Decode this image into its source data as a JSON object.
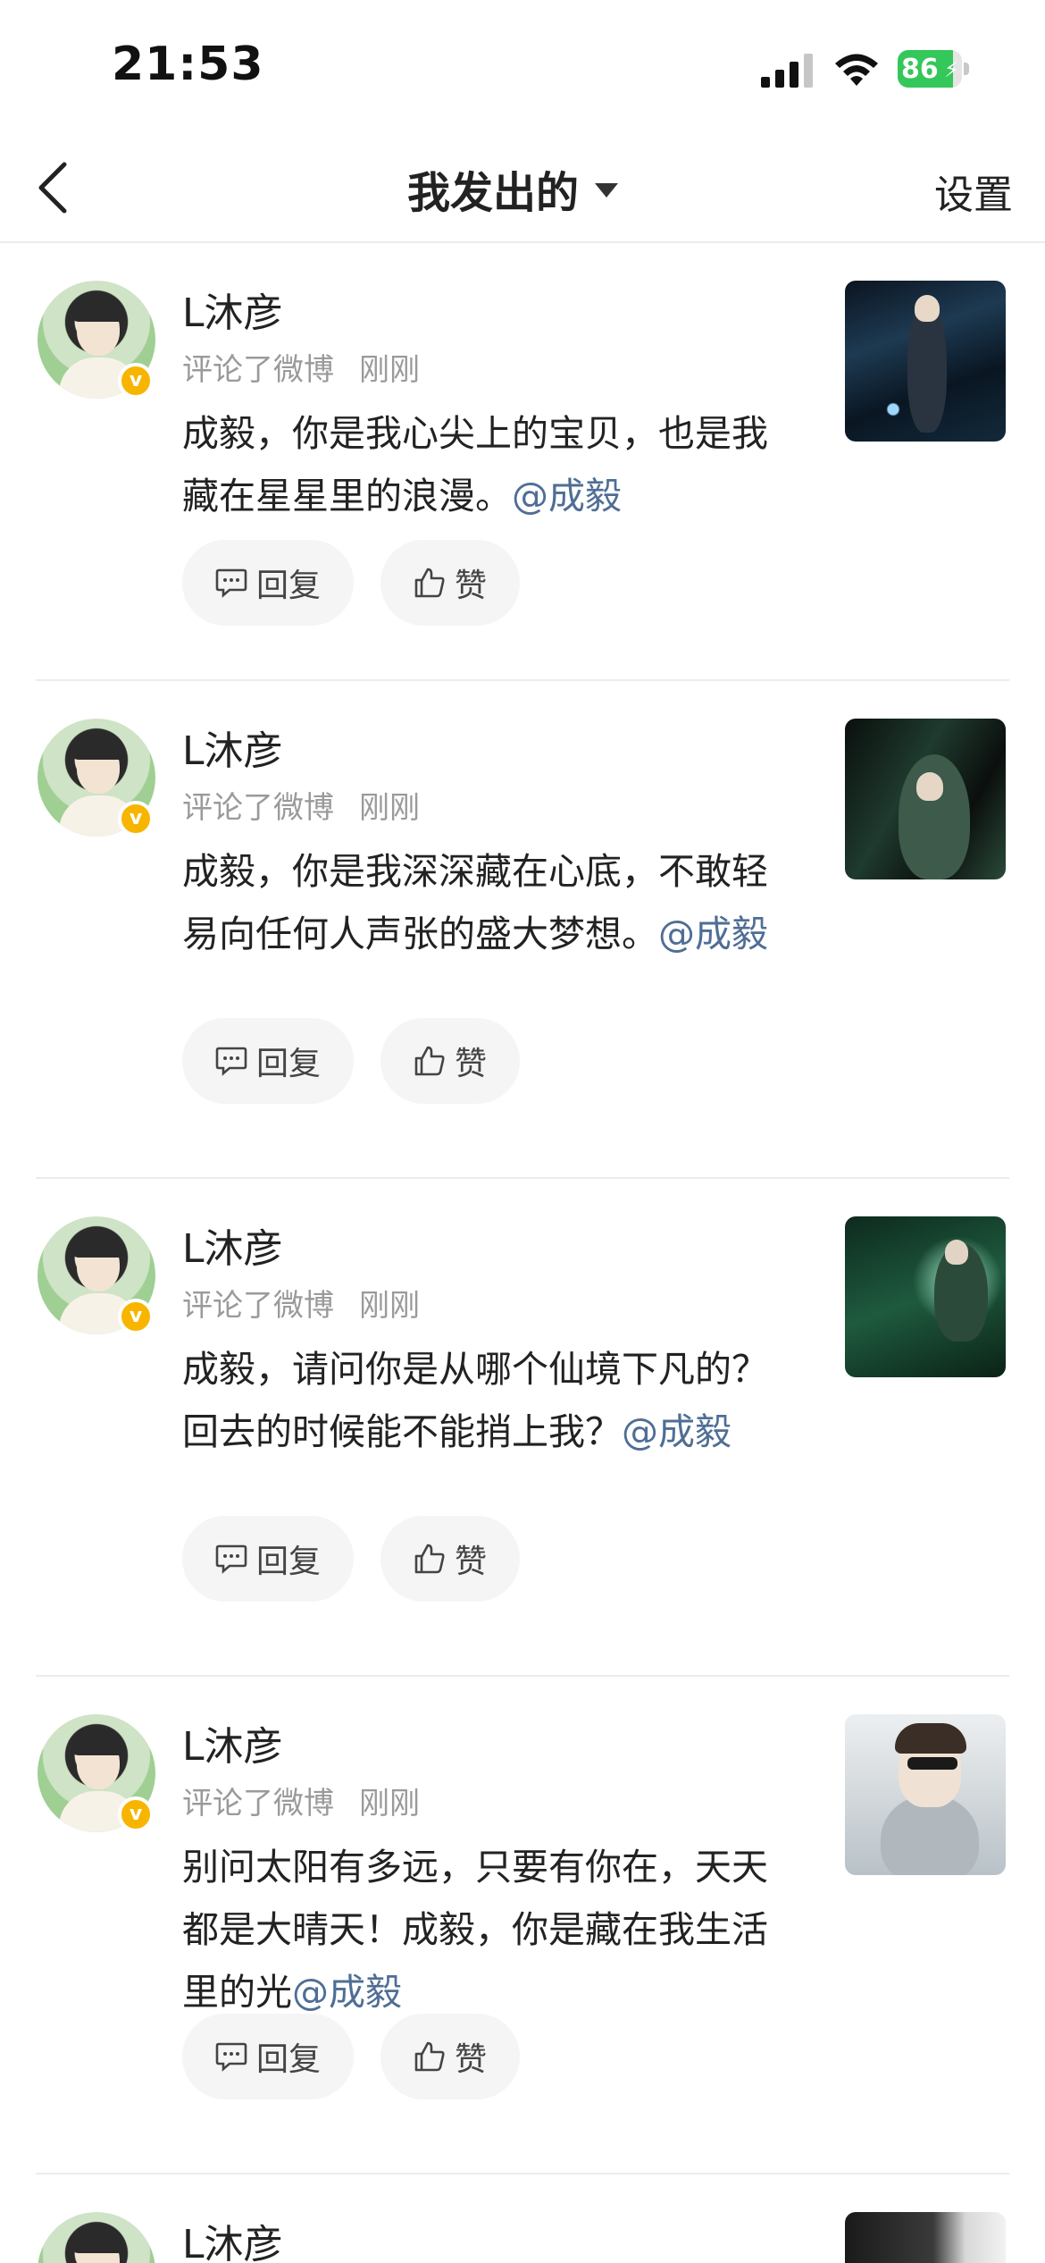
{
  "status_bar": {
    "time": "21:53",
    "battery": "86",
    "battery_level": 0.86
  },
  "nav": {
    "title": "我发出的",
    "settings": "设置"
  },
  "icons": {
    "back": "chevron-left-icon",
    "caret": "caret-down-icon",
    "reply": "comment-icon",
    "like": "thumbs-up-icon",
    "verified": "verified-badge-icon"
  },
  "colors": {
    "mention": "#4f6e95",
    "verified": "#f7b500",
    "battery": "#34c759"
  },
  "items": [
    {
      "name": "L沐彦",
      "action": "评论了微博",
      "time": "刚刚",
      "text": "成毅，你是我心尖上的宝贝，也是我藏在星星里的浪漫。",
      "mention": "@成毅",
      "reply_label": "回复",
      "like_label": "赞"
    },
    {
      "name": "L沐彦",
      "action": "评论了微博",
      "time": "刚刚",
      "text": "成毅，你是我深深藏在心底，不敢轻易向任何人声张的盛大梦想。",
      "mention": "@成毅",
      "reply_label": "回复",
      "like_label": "赞"
    },
    {
      "name": "L沐彦",
      "action": "评论了微博",
      "time": "刚刚",
      "text": "成毅，请问你是从哪个仙境下凡的？回去的时候能不能捎上我？",
      "mention": "@成毅",
      "reply_label": "回复",
      "like_label": "赞"
    },
    {
      "name": "L沐彦",
      "action": "评论了微博",
      "time": "刚刚",
      "text": "别问太阳有多远，只要有你在，天天都是大晴天！成毅，你是藏在我生活里的光",
      "mention": "@成毅",
      "reply_label": "回复",
      "like_label": "赞"
    },
    {
      "name": "L沐彦"
    }
  ]
}
